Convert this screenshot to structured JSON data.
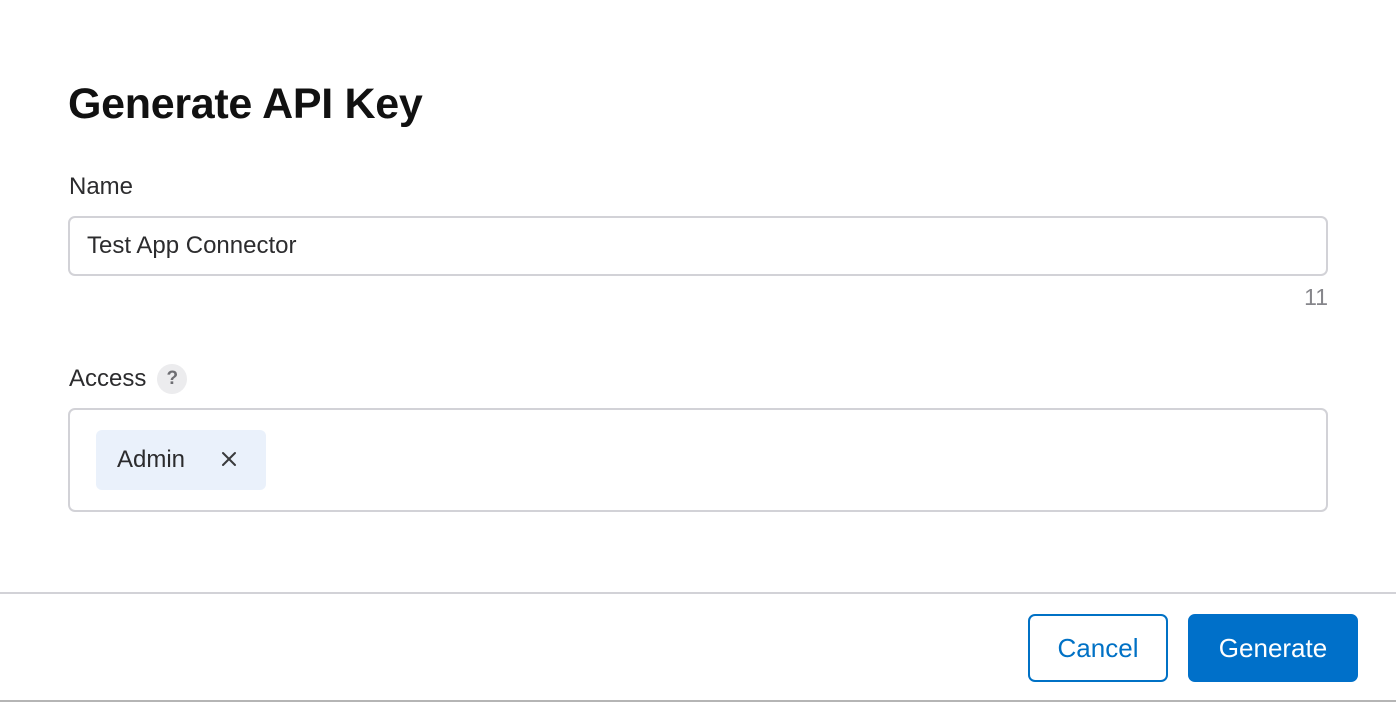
{
  "dialog": {
    "title": "Generate API Key"
  },
  "name_field": {
    "label": "Name",
    "value": "Test App Connector",
    "char_count": "11"
  },
  "access_field": {
    "label": "Access",
    "help_icon": "question-mark-icon",
    "help_glyph": "?",
    "selected": [
      {
        "label": "Admin",
        "remove_icon": "close-icon"
      }
    ]
  },
  "footer": {
    "cancel_label": "Cancel",
    "generate_label": "Generate"
  },
  "colors": {
    "accent": "#0070c9",
    "chip_background": "#eaf1fb",
    "border": "#d2d2d7"
  }
}
